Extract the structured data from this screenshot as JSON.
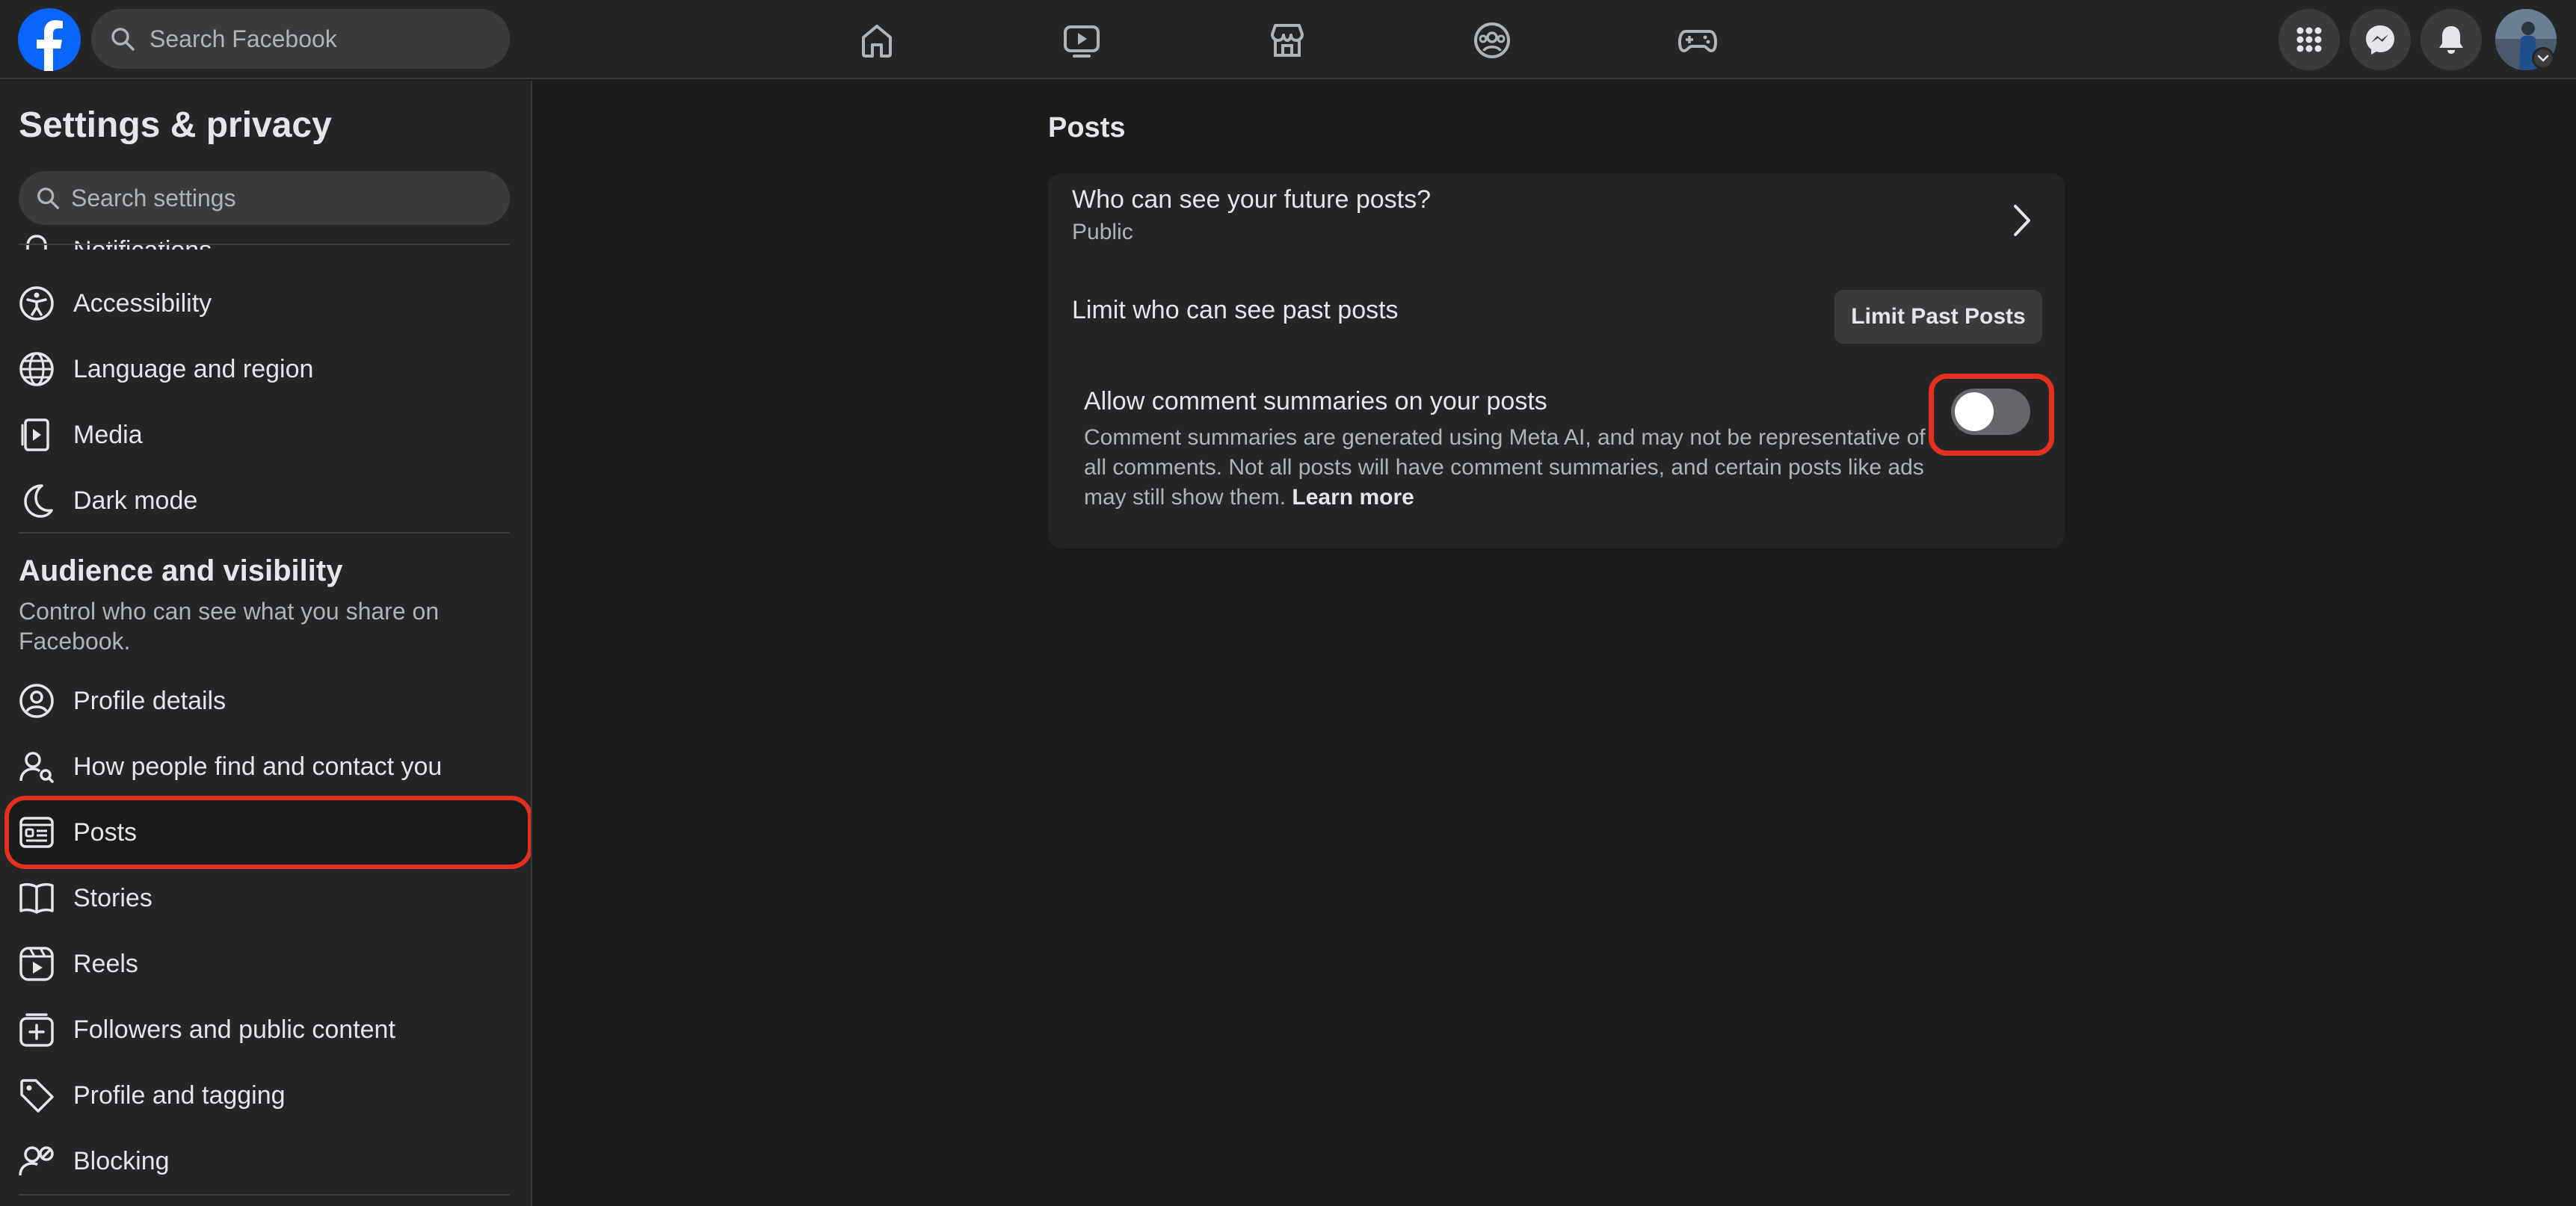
{
  "topbar": {
    "search_placeholder": "Search Facebook",
    "nav": [
      "home-icon",
      "video-icon",
      "marketplace-icon",
      "groups-icon",
      "gaming-icon"
    ],
    "right": [
      "menu-grid-icon",
      "messenger-icon",
      "bell-icon",
      "avatar"
    ]
  },
  "sidebar": {
    "title": "Settings & privacy",
    "search_placeholder": "Search settings",
    "items_top": [
      {
        "label": "Notifications",
        "icon": "bell-icon"
      },
      {
        "label": "Accessibility",
        "icon": "accessibility-icon"
      },
      {
        "label": "Language and region",
        "icon": "globe-icon"
      },
      {
        "label": "Media",
        "icon": "media-icon"
      },
      {
        "label": "Dark mode",
        "icon": "moon-icon"
      }
    ],
    "section": {
      "title": "Audience and visibility",
      "description": "Control who can see what you share on Facebook."
    },
    "items_section": [
      {
        "label": "Profile details",
        "icon": "profile-icon"
      },
      {
        "label": "How people find and contact you",
        "icon": "person-search-icon"
      },
      {
        "label": "Posts",
        "icon": "posts-icon"
      },
      {
        "label": "Stories",
        "icon": "book-icon"
      },
      {
        "label": "Reels",
        "icon": "reels-icon"
      },
      {
        "label": "Followers and public content",
        "icon": "followers-icon"
      },
      {
        "label": "Profile and tagging",
        "icon": "tag-icon"
      },
      {
        "label": "Blocking",
        "icon": "block-user-icon"
      }
    ]
  },
  "main": {
    "title": "Posts",
    "future_posts": {
      "title": "Who can see your future posts?",
      "value": "Public"
    },
    "past_posts": {
      "title": "Limit who can see past posts",
      "button": "Limit Past Posts"
    },
    "comment_summaries": {
      "title": "Allow comment summaries on your posts",
      "description": "Comment summaries are generated using Meta AI, and may not be representative of all comments. Not all posts will have comment summaries, and certain posts like ads may still show them.",
      "learn_more": "Learn more",
      "enabled": false
    }
  },
  "colors": {
    "background": "#1c1c1d",
    "surface": "#242526",
    "input": "#3a3b3c",
    "highlight": "#e3301f",
    "brand": "#0866ff"
  }
}
